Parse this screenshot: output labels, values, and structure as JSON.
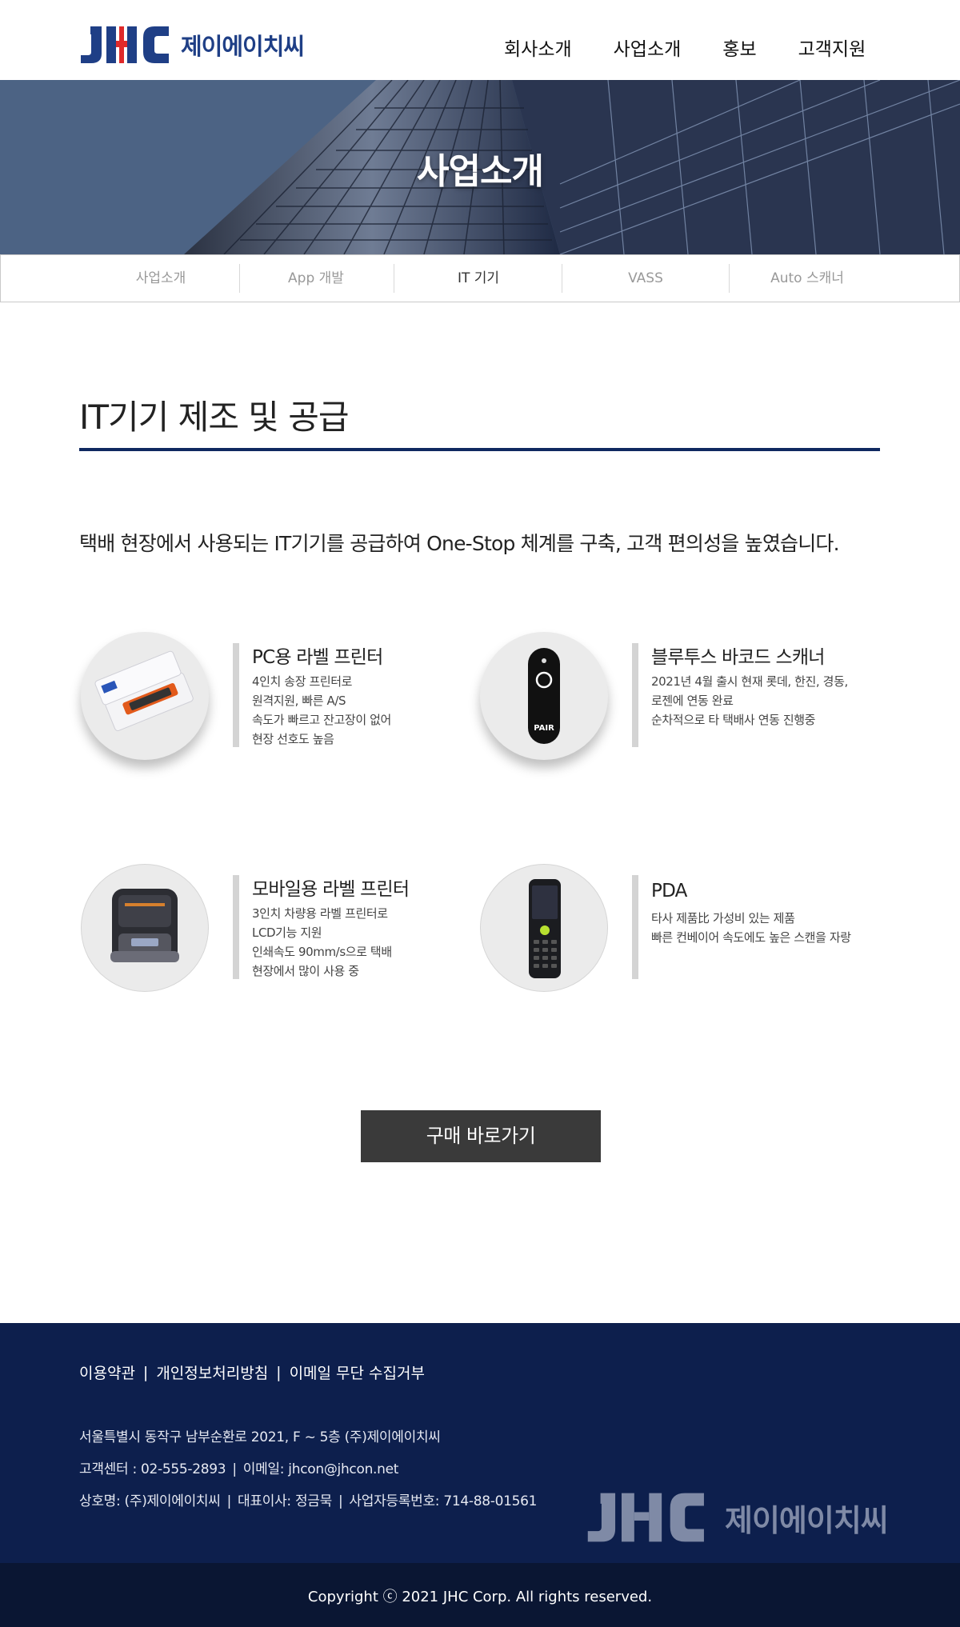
{
  "header": {
    "logo_text": "제이에이치씨",
    "nav": [
      "회사소개",
      "사업소개",
      "홍보",
      "고객지원"
    ]
  },
  "hero": {
    "title": "사업소개"
  },
  "subnav": {
    "items": [
      "사업소개",
      "App 개발",
      "IT 기기",
      "VASS",
      "Auto 스캐너"
    ],
    "active": "IT 기기"
  },
  "section": {
    "title": "IT기기 제조 및 공급",
    "description": "택배 현장에서 사용되는 IT기기를 공급하여 One-Stop 체계를 구축, 고객 편의성을 높였습니다."
  },
  "products": [
    {
      "name": "PC용 라벨 프린터",
      "lines": [
        "4인치 송장 프린터로",
        "원격지원, 빠른 A/S",
        "속도가 빠르고 잔고장이 없어",
        "현장 선호도 높음"
      ],
      "icon": "label-printer-icon"
    },
    {
      "name": "블루투스 바코드 스캐너",
      "lines": [
        "2021년 4월 출시 현재 롯데, 한진, 경동,",
        "로젠에 연동 완료",
        "순차적으로 타 택배사 연동 진행중"
      ],
      "icon": "barcode-scanner-icon",
      "device_label": "PAIR"
    },
    {
      "name": "모바일용 라벨 프린터",
      "lines": [
        "3인치 차량용 라벨 프린터로",
        "LCD기능 지원",
        "인쇄속도 90mm/s으로 택배",
        "현장에서 많이 사용 중"
      ],
      "icon": "mobile-printer-icon"
    },
    {
      "name": "PDA",
      "lines": [
        "타사 제품比 가성비 있는 제품",
        "빠른 컨베이어 속도에도 높은 스캔을 자랑"
      ],
      "icon": "pda-icon"
    }
  ],
  "buy_button": "구매 바로가기",
  "footer": {
    "links": [
      "이용약관",
      "개인정보처리방침",
      "이메일 무단 수집거부"
    ],
    "address": "서울특별시 동작구 남부순환로 2021, F ~ 5층 (주)제이에이치씨",
    "contact": [
      "고객센터 : 02-555-2893",
      "이메일: jhcon@jhcon.net"
    ],
    "company": [
      "상호명: (주)제이에이치씨",
      "대표이사: 정금묵",
      "사업자등록번호: 714-88-01561"
    ],
    "logo_text": "제이에이치씨",
    "copyright": "Copyright ⓒ 2021 JHC Corp. All rights reserved."
  },
  "colors": {
    "brand_blue": "#1f3f86",
    "accent_red": "#e02a2a",
    "rule_navy": "#0f2860",
    "footer_bg": "#0d1f4d",
    "copyright_bg": "#0a1633",
    "button_bg": "#3a3a3a"
  }
}
